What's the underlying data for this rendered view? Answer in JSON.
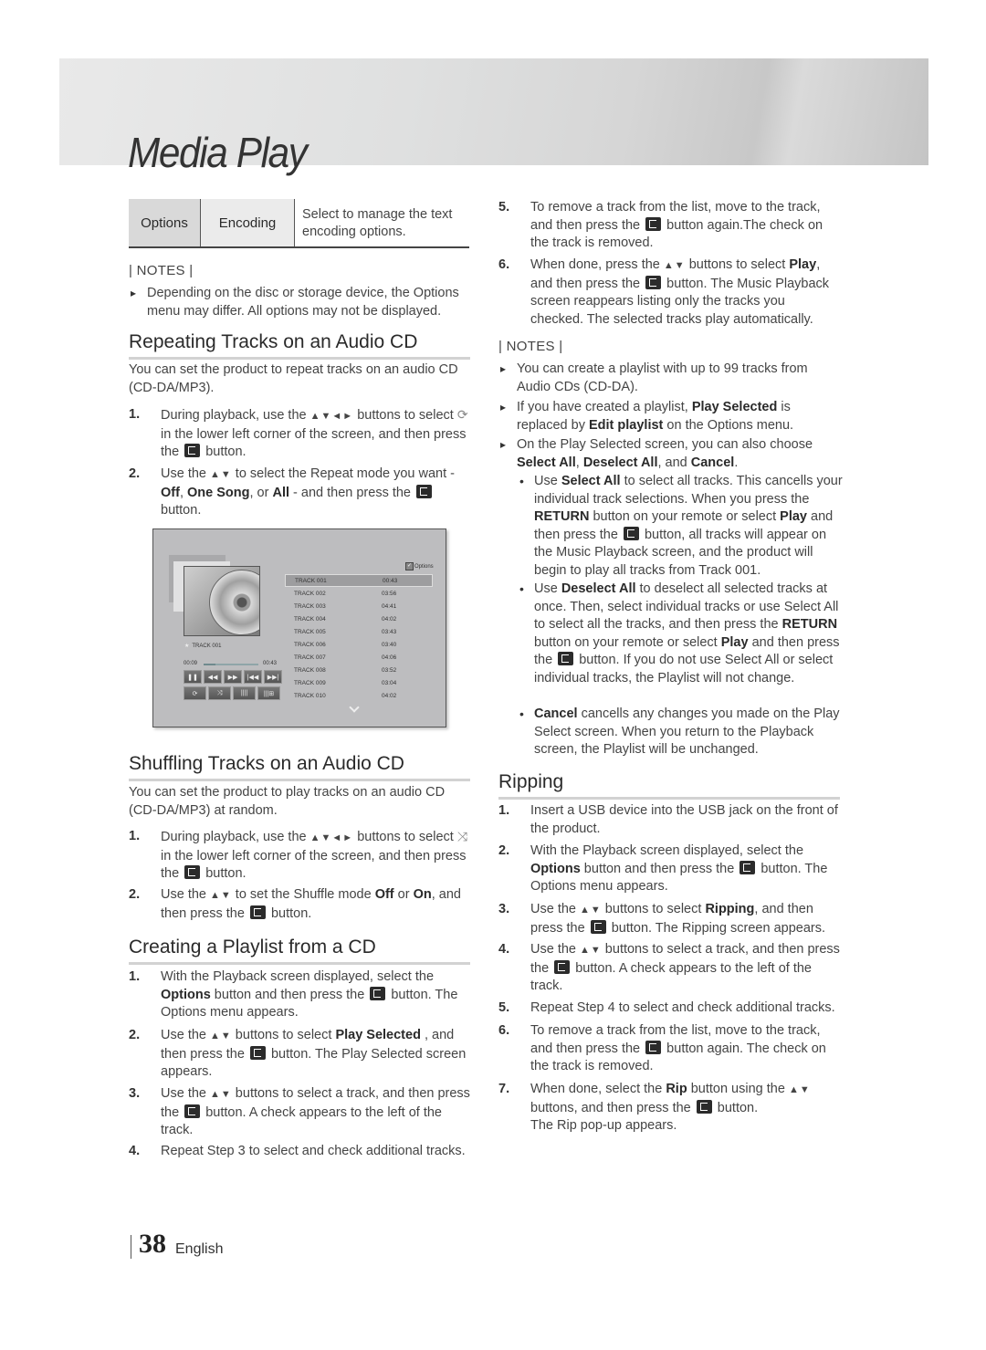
{
  "header": {
    "title": "Media Play"
  },
  "options_table": {
    "col1": "Options",
    "col2": "Encoding",
    "description": "Select to manage the text encoding options."
  },
  "notes_label": "| NOTES |",
  "notes_top": [
    "Depending on the disc or storage device, the Options menu may differ. All options may not be displayed."
  ],
  "repeat": {
    "title": "Repeating Tracks on an Audio CD",
    "intro": "You can set the product to repeat tracks on an audio CD (CD-DA/MP3).",
    "steps": [
      {
        "num": "1.",
        "a": "During playback, use the ",
        "arrows": "▲▼◄►",
        "b": " buttons to select ",
        "c": " in the lower left corner of the screen, and then press the ",
        "d": " button."
      },
      {
        "num": "2.",
        "a": "Use the ",
        "arrows": "▲▼",
        "b": " to select the Repeat mode you want - ",
        "bold1": "Off",
        "sep1": ", ",
        "bold2": "One Song",
        "sep2": ", or ",
        "bold3": "All",
        "c": " - and then press the ",
        "d": " button."
      }
    ]
  },
  "screen": {
    "options_label": "Options",
    "now_playing": "TRACK 001",
    "elapsed": "00:09",
    "total": "00:43",
    "progress_fraction": 0.21,
    "tracks": [
      {
        "name": "TRACK 001",
        "time": "00:43",
        "selected": true
      },
      {
        "name": "TRACK 002",
        "time": "03:56"
      },
      {
        "name": "TRACK 003",
        "time": "04:41"
      },
      {
        "name": "TRACK 004",
        "time": "04:02"
      },
      {
        "name": "TRACK 005",
        "time": "03:43"
      },
      {
        "name": "TRACK 006",
        "time": "03:40"
      },
      {
        "name": "TRACK 007",
        "time": "04:06"
      },
      {
        "name": "TRACK 008",
        "time": "03:52"
      },
      {
        "name": "TRACK 009",
        "time": "03:04"
      },
      {
        "name": "TRACK 010",
        "time": "04:02"
      }
    ],
    "controls": [
      "pause-icon",
      "rewind-icon",
      "fast-forward-icon",
      "skip-previous-icon",
      "skip-next-icon"
    ],
    "controls2": [
      "repeat-icon",
      "shuffle-icon",
      "equalizer-icon",
      "sound-settings-icon"
    ]
  },
  "shuffle": {
    "title": "Shuffling Tracks on an Audio CD",
    "intro": "You can set the product to play tracks on an audio CD (CD-DA/MP3) at random.",
    "steps": [
      {
        "num": "1.",
        "a": "During playback, use the ",
        "arrows": "▲▼◄►",
        "b": " buttons to select ",
        "c": " in the lower left corner of the screen, and then press the ",
        "d": " button."
      },
      {
        "num": "2.",
        "a": "Use the ",
        "arrows": "▲▼",
        "b": " to set the Shuffle mode ",
        "bold1": "Off",
        "sep1": " or ",
        "bold2": "On",
        "c": ", and then press the ",
        "d": " button."
      }
    ]
  },
  "playlist": {
    "title": "Creating a Playlist from a CD",
    "steps": [
      {
        "num": "1.",
        "a": "With the Playback screen displayed, select the ",
        "bold1": "Options",
        "b": " button and then press the ",
        "c": " button. The Options menu appears."
      },
      {
        "num": "2.",
        "a": "Use the ",
        "arrows": "▲▼",
        "b": " buttons to select ",
        "bold1": "Play Selected",
        "c": " , and then press the ",
        "d": " button. The Play Selected screen appears."
      },
      {
        "num": "3.",
        "a": "Use the ",
        "arrows": "▲▼",
        "b": " buttons to select a track, and then press the ",
        "c": " button. A check appears to the left of the track."
      },
      {
        "num": "4.",
        "a": "Repeat Step 3 to select and check additional tracks."
      },
      {
        "num": "5.",
        "a": "To remove a track from the list, move to the track, and then press the ",
        "b": " button again.The check on the track is removed."
      },
      {
        "num": "6.",
        "a": "When done, press the ",
        "arrows": "▲▼",
        "b": " buttons to select ",
        "bold1": "Play",
        "c": ", and then press the ",
        "d": " button. The Music Playback screen reappears listing only the tracks you checked. The selected tracks play automatically."
      }
    ],
    "notes": [
      {
        "a": "You can create a playlist with up to 99 tracks from Audio CDs (CD-DA)."
      },
      {
        "a": "If you have created a playlist, ",
        "bold1": "Play Selected",
        "b": " is replaced by ",
        "bold2": "Edit playlist",
        "c": " on the Options menu."
      },
      {
        "a": "On the Play Selected screen, you can also choose ",
        "bold1": "Select All",
        "b": ", ",
        "bold2": "Deselect All",
        "c": ", and ",
        "bold3": "Cancel",
        "d": "."
      }
    ],
    "sub_bullets": [
      {
        "a": "Use ",
        "bold1": "Select All",
        "b": " to select all tracks. This cancells your individual track selections. When you press the ",
        "bold2": "RETURN",
        "c": " button on your remote or select ",
        "bold3": "Play",
        "d": " and then press the ",
        "e": " button, all tracks will appear on the Music Playback screen, and the product will begin to play all tracks from Track 001."
      },
      {
        "a": "Use ",
        "bold1": "Deselect All",
        "b": " to deselect all selected tracks at once. Then, select individual tracks or use Select All to select all the tracks, and then press the ",
        "bold2": "RETURN",
        "c": " button on your remote or select ",
        "bold3": "Play",
        "d": " and then press the ",
        "e": " button. If you do not use Select All or select individual tracks, the Playlist will not change."
      },
      {
        "bold1": "Cancel",
        "a": " cancells any changes you made on the Play Select screen. When you return to the Playback screen, the Playlist will be unchanged."
      }
    ]
  },
  "ripping": {
    "title": "Ripping",
    "steps": [
      {
        "num": "1.",
        "a": "Insert a USB device into the USB jack on the front of the product."
      },
      {
        "num": "2.",
        "a": "With the Playback screen displayed, select the ",
        "bold1": "Options",
        "b": " button and then press the ",
        "c": " button. The Options menu appears."
      },
      {
        "num": "3.",
        "a": "Use the ",
        "arrows": "▲▼",
        "b": " buttons to select ",
        "bold1": "Ripping",
        "c": ", and then press the ",
        "d": " button. The Ripping screen appears."
      },
      {
        "num": "4.",
        "a": "Use the ",
        "arrows": "▲▼",
        "b": " buttons to select a track, and then press the ",
        "c": " button. A check appears to the left of the track."
      },
      {
        "num": "5.",
        "a": "Repeat Step 4 to select and check additional tracks."
      },
      {
        "num": "6.",
        "a": "To remove a track from the list, move to the track, and then press the ",
        "b": " button again. The check on the track is removed."
      },
      {
        "num": "7.",
        "a": "When done, select the ",
        "bold1": "Rip",
        "b": " button using the ",
        "arrows": "▲▼",
        "c": " buttons, and then press the ",
        "d": " button.",
        "e": "The Rip pop-up appears."
      }
    ]
  },
  "footer": {
    "page_number": "38",
    "language": "English"
  }
}
